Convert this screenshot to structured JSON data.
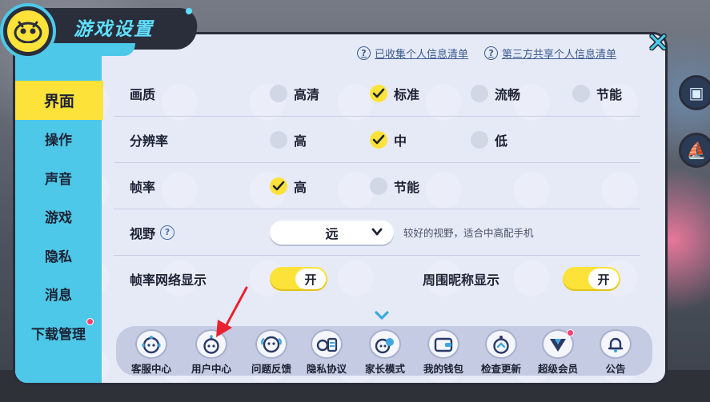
{
  "window": {
    "title": "游戏设置"
  },
  "close_label": "✕",
  "top_links": [
    {
      "label": "已收集个人信息清单"
    },
    {
      "label": "第三方共享个人信息清单"
    }
  ],
  "sidebar": {
    "items": [
      {
        "label": "界面",
        "active": true
      },
      {
        "label": "操作"
      },
      {
        "label": "声音"
      },
      {
        "label": "游戏"
      },
      {
        "label": "隐私"
      },
      {
        "label": "消息"
      },
      {
        "label": "下载管理",
        "badge": true
      }
    ]
  },
  "settings": {
    "quality": {
      "label": "画质",
      "options": [
        "高清",
        "标准",
        "流畅",
        "节能"
      ],
      "selected": "标准"
    },
    "resolution": {
      "label": "分辨率",
      "options": [
        "高",
        "中",
        "低"
      ],
      "selected": "中"
    },
    "framerate": {
      "label": "帧率",
      "options": [
        "高",
        "节能"
      ],
      "selected": "高"
    },
    "view": {
      "label": "视野",
      "help": "?",
      "value": "远",
      "note": "较好的视野，适合中高配手机"
    },
    "fps_display": {
      "label": "帧率网络显示",
      "toggle": "开"
    },
    "nickname_display": {
      "label": "周围昵称显示",
      "toggle": "开"
    }
  },
  "bottom_bar": [
    {
      "label": "客服中心",
      "icon": "support-icon"
    },
    {
      "label": "用户中心",
      "icon": "user-icon"
    },
    {
      "label": "问题反馈",
      "icon": "feedback-icon"
    },
    {
      "label": "隐私协议",
      "icon": "privacy-icon"
    },
    {
      "label": "家长模式",
      "icon": "parent-icon"
    },
    {
      "label": "我的钱包",
      "icon": "wallet-icon"
    },
    {
      "label": "检查更新",
      "icon": "update-icon"
    },
    {
      "label": "超级会员",
      "icon": "vip-icon",
      "badge": true
    },
    {
      "label": "公告",
      "icon": "bell-icon"
    }
  ],
  "colors": {
    "accent_yellow": "#fde23a",
    "accent_cyan": "#4dc8e8",
    "panel_bg": "#e6eaf7",
    "dark": "#2a2d3a",
    "badge_red": "#ff3d6e",
    "annotation_red": "#e8232f"
  }
}
